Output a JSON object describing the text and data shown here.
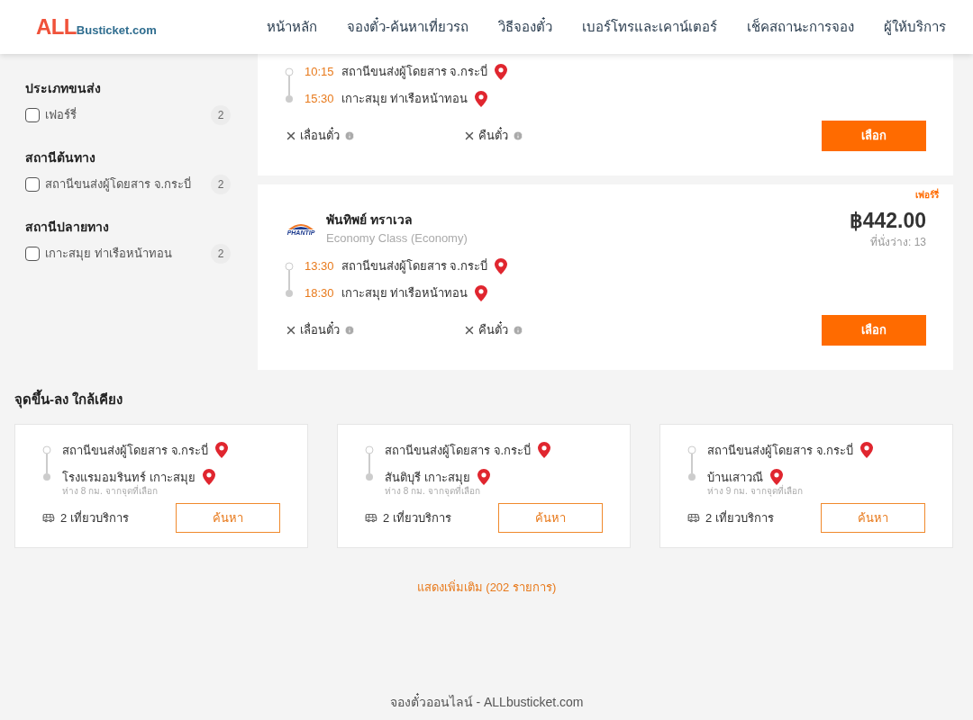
{
  "header": {
    "logo": {
      "first": "ALL",
      "rest": "Busticket.com"
    },
    "nav": [
      {
        "label": "หน้าหลัก"
      },
      {
        "label": "จองตั๋ว-ค้นหาเที่ยวรถ"
      },
      {
        "label": "วิธีจองตั๋ว"
      },
      {
        "label": "เบอร์โทรและเคาน์เตอร์"
      },
      {
        "label": "เช็คสถานะการจอง"
      },
      {
        "label": "ผู้ให้บริการ"
      }
    ]
  },
  "filters": [
    {
      "title": "ประเภทขนส่ง",
      "options": [
        {
          "label": "เฟอร์รี่",
          "count": "2",
          "checked": false
        }
      ]
    },
    {
      "title": "สถานีต้นทาง",
      "options": [
        {
          "label": "สถานีขนส่งผู้โดยสาร จ.กระบี่",
          "count": "2",
          "checked": false
        }
      ]
    },
    {
      "title": "สถานีปลายทาง",
      "options": [
        {
          "label": "เกาะสมุย ท่าเรือหน้าทอน",
          "count": "2",
          "checked": false
        }
      ]
    }
  ],
  "trips": [
    {
      "stops": [
        {
          "time": "10:15",
          "name": "สถานีขนส่งผู้โดยสาร จ.กระบี่"
        },
        {
          "time": "15:30",
          "name": "เกาะสมุย ท่าเรือหน้าทอน"
        }
      ],
      "policies": [
        {
          "label": "เลื่อนตั๋ว"
        },
        {
          "label": "คืนตั๋ว"
        }
      ],
      "button": "เลือก"
    },
    {
      "badge": "เฟอร์รี่",
      "logo_text": "PHANTIP",
      "operator": "พันทิพย์ ทราเวล",
      "class": "Economy Class (Economy)",
      "price": "฿442.00",
      "seats": "ที่นั่งว่าง: 13",
      "stops": [
        {
          "time": "13:30",
          "name": "สถานีขนส่งผู้โดยสาร จ.กระบี่"
        },
        {
          "time": "18:30",
          "name": "เกาะสมุย ท่าเรือหน้าทอน"
        }
      ],
      "policies": [
        {
          "label": "เลื่อนตั๋ว"
        },
        {
          "label": "คืนตั๋ว"
        }
      ],
      "button": "เลือก"
    }
  ],
  "nearby": {
    "title": "จุดขึ้น-ลง ใกล้เคียง",
    "cards": [
      {
        "from": "สถานีขนส่งผู้โดยสาร จ.กระบี่",
        "to": "โรงแรมอมรินทร์ เกาะสมุย",
        "distance": "ห่าง 8 กม. จากจุดที่เลือก",
        "trips": "2 เที่ยวบริการ",
        "button": "ค้นหา"
      },
      {
        "from": "สถานีขนส่งผู้โดยสาร จ.กระบี่",
        "to": "สันติบุรี เกาะสมุย",
        "distance": "ห่าง 8 กม. จากจุดที่เลือก",
        "trips": "2 เที่ยวบริการ",
        "button": "ค้นหา"
      },
      {
        "from": "สถานีขนส่งผู้โดยสาร จ.กระบี่",
        "to": "บ้านเสาวณี",
        "distance": "ห่าง 9 กม. จากจุดที่เลือก",
        "trips": "2 เที่ยวบริการ",
        "button": "ค้นหา"
      }
    ]
  },
  "show_more": "แสดงเพิ่มเติม (202 รายการ)",
  "footer": "จองตั๋วออนไลน์ - ALLbusticket.com"
}
